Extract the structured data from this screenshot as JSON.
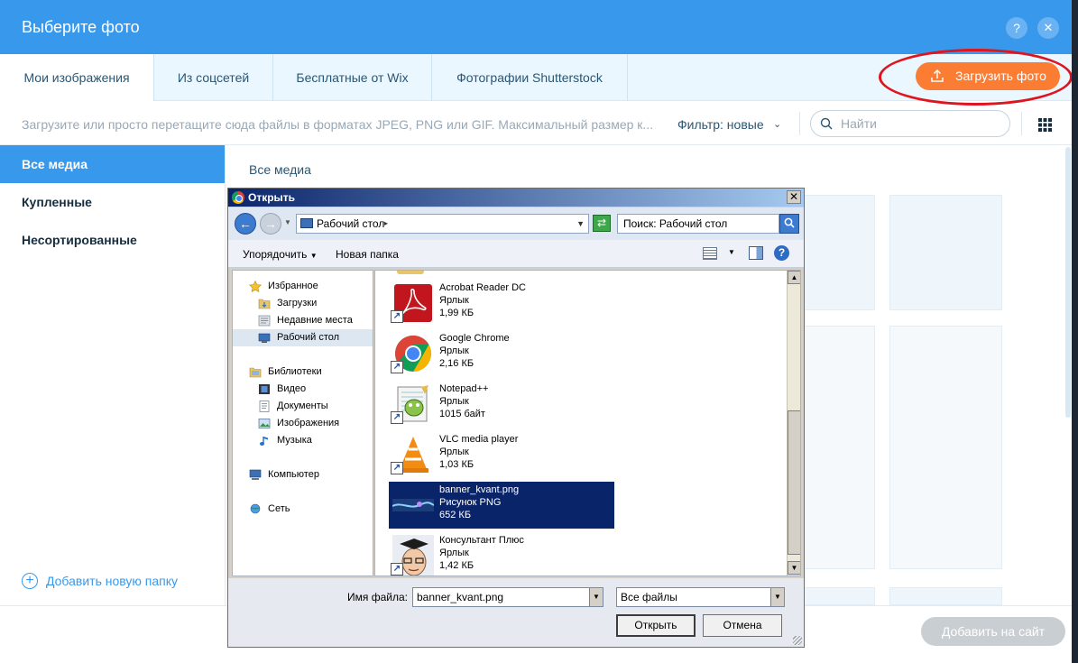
{
  "wix": {
    "title": "Выберите фото",
    "help": "?",
    "close": "✕",
    "tabs": [
      "Мои изображения",
      "Из соцсетей",
      "Бесплатные от Wix",
      "Фотографии Shutterstock"
    ],
    "upload_label": "Загрузить фото",
    "hint": "Загрузите или просто перетащите сюда файлы в форматах JPEG, PNG или GIF. Максимальный размер к...",
    "filter_label": "Фильтр: новые",
    "search_placeholder": "Найти",
    "sidebar": [
      "Все медиа",
      "Купленные",
      "Несортированные"
    ],
    "add_folder": "Добавить новую папку",
    "breadcrumb": "Все медиа",
    "add_to_site": "Добавить на сайт",
    "accent": "#3899ec",
    "upload_color": "#fb7d33"
  },
  "dialog": {
    "title": "Открыть",
    "address": "Рабочий стол",
    "search": "Поиск: Рабочий стол",
    "organize": "Упорядочить",
    "new_folder": "Новая папка",
    "nav": [
      {
        "label": "Избранное",
        "icon": "star-icon"
      },
      {
        "label": "Загрузки",
        "icon": "downloads-folder-icon"
      },
      {
        "label": "Недавние места",
        "icon": "recent-places-icon"
      },
      {
        "label": "Рабочий стол",
        "icon": "desktop-icon"
      },
      {
        "label": "Библиотеки",
        "icon": "libraries-icon"
      },
      {
        "label": "Видео",
        "icon": "video-icon"
      },
      {
        "label": "Документы",
        "icon": "documents-icon"
      },
      {
        "label": "Изображения",
        "icon": "images-icon"
      },
      {
        "label": "Музыка",
        "icon": "music-icon"
      },
      {
        "label": "Компьютер",
        "icon": "computer-icon"
      },
      {
        "label": "Сеть",
        "icon": "network-icon"
      }
    ],
    "files": [
      {
        "name": "Acrobat Reader DC",
        "type": "Ярлык",
        "size": "1,99 КБ"
      },
      {
        "name": "Google Chrome",
        "type": "Ярлык",
        "size": "2,16 КБ"
      },
      {
        "name": "Notepad++",
        "type": "Ярлык",
        "size": "1015 байт"
      },
      {
        "name": "VLC media player",
        "type": "Ярлык",
        "size": "1,03 КБ"
      },
      {
        "name": "banner_kvant.png",
        "type": "Рисунок PNG",
        "size": "652 КБ"
      },
      {
        "name": "Консультант Плюс",
        "type": "Ярлык",
        "size": "1,42 КБ"
      }
    ],
    "filename_label": "Имя файла:",
    "filename_value": "banner_kvant.png",
    "filetype_value": "Все файлы",
    "open_label": "Открыть",
    "cancel_label": "Отмена"
  }
}
